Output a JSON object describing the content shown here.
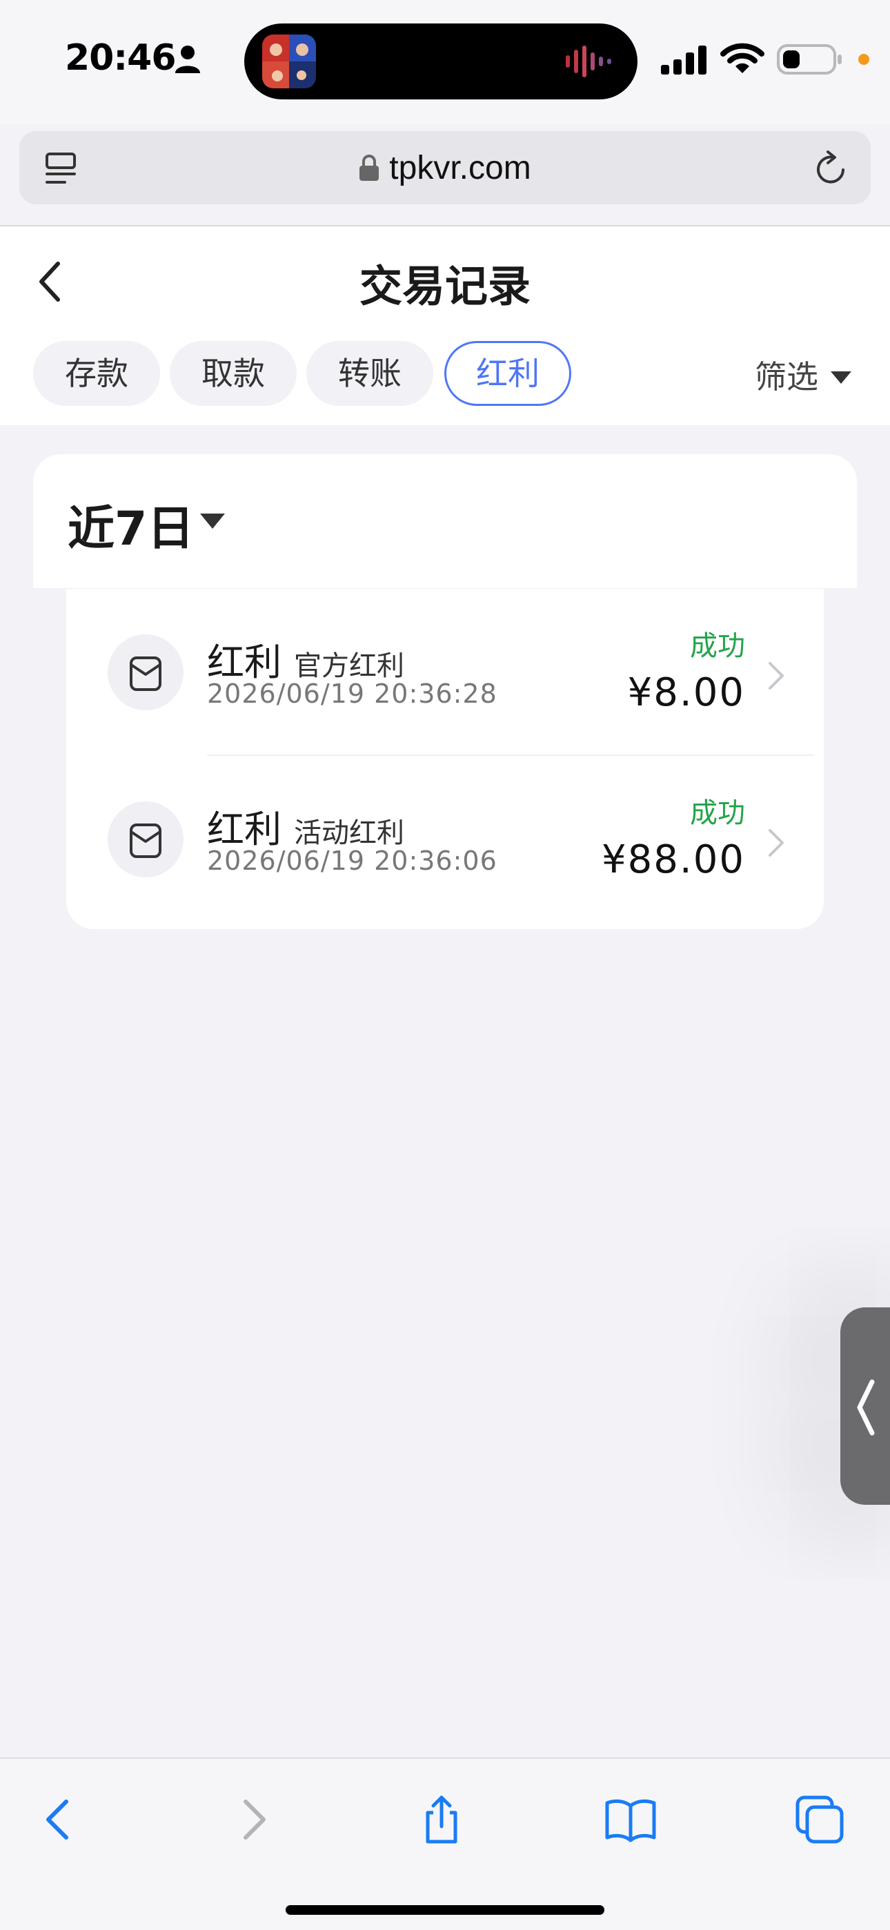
{
  "status_bar": {
    "time": "20:46"
  },
  "browser": {
    "url": "tpkvr.com"
  },
  "header": {
    "title": "交易记录",
    "tabs": [
      {
        "label": "存款"
      },
      {
        "label": "取款"
      },
      {
        "label": "转账"
      },
      {
        "label": "红利",
        "active": true
      }
    ],
    "filter_label": "筛选"
  },
  "range": {
    "label": "近7日"
  },
  "transactions": [
    {
      "title": "红利",
      "subtitle": "官方红利",
      "date": "2026/06/19 20:36:28",
      "status": "成功",
      "amount": "¥8.00"
    },
    {
      "title": "红利",
      "subtitle": "活动红利",
      "date": "2026/06/19 20:36:06",
      "status": "成功",
      "amount": "¥88.00"
    }
  ],
  "colors": {
    "accent": "#4f76f5",
    "success": "#23a44a",
    "ios_blue": "#1a7cf5"
  },
  "icons": {
    "status": [
      "person-icon",
      "signal-icon",
      "wifi-icon",
      "battery-icon"
    ],
    "browser": [
      "reader-icon",
      "lock-icon",
      "reload-icon"
    ],
    "toolbar": [
      "back-arrow-icon",
      "forward-arrow-icon",
      "share-icon",
      "bookmarks-icon",
      "tabs-icon"
    ]
  }
}
